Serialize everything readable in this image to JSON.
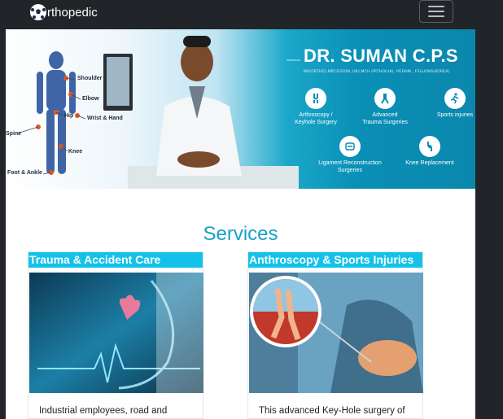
{
  "navbar": {
    "brand_text": "rthopedic",
    "logo_icon": "soccer-ball-icon",
    "menu_icon": "hamburger-menu-icon"
  },
  "hero": {
    "doctor_name": "DR. SUMAN C.P.S",
    "qualifications": "MS(ORTHO),MRCS(EDIN.,UK),MCH ORTHO(UK), PGDHM., FELLOWS(KOREA)",
    "services": [
      {
        "line1": "Arthroscopy /",
        "line2": "Keyhole Surgery",
        "icon": "knee-joint-icon"
      },
      {
        "line1": "Advanced",
        "line2": "Trauma Surgeries",
        "icon": "leg-bone-icon"
      },
      {
        "line1": "Sports injuries",
        "line2": "",
        "icon": "running-person-icon"
      },
      {
        "line1": "Ligament Reconstruction",
        "line2": "Surgeries",
        "icon": "ligament-icon"
      },
      {
        "line1": "Knee Replacement",
        "line2": "",
        "icon": "knee-replacement-icon"
      }
    ],
    "body_labels": [
      "Shoulder",
      "Elbow",
      "Hip",
      "Wrist & Hand",
      "Spine",
      "Knee",
      "Foot & Ankle"
    ]
  },
  "services_section": {
    "title": "Services",
    "cards": [
      {
        "title": "Trauma & Accident Care",
        "text": "Industrial employees, road and"
      },
      {
        "title": "Anthroscopy & Sports Injuries",
        "text": "This advanced Key-Hole surgery of"
      }
    ]
  },
  "colors": {
    "navbar": "#212529",
    "accent": "#17a2c8",
    "card_title_bg": "#12c2e9"
  }
}
